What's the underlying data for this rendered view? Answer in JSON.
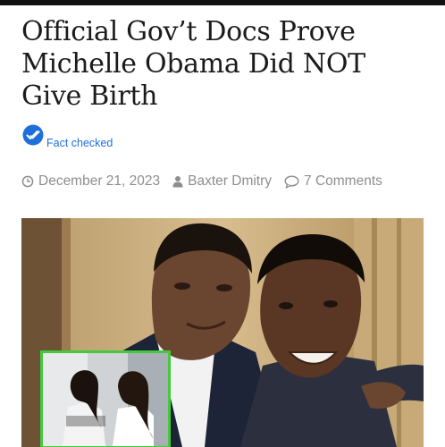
{
  "article": {
    "title": "Official Gov’t Docs Prove Michelle Obama Did NOT Give Birth",
    "fact_check_label": "Fact checked",
    "date": "December 21, 2023",
    "author": "Baxter Dmitry",
    "comments": "7 Comments"
  },
  "icons": {
    "fact_check": "check-badge-icon",
    "date": "clock-icon",
    "author": "user-icon",
    "comments": "speech-bubble-icon"
  },
  "colors": {
    "accent_blue": "#1e6fd9",
    "meta_gray": "#8e8e8e",
    "inset_border": "#44c93e",
    "top_bar": "#111111"
  }
}
